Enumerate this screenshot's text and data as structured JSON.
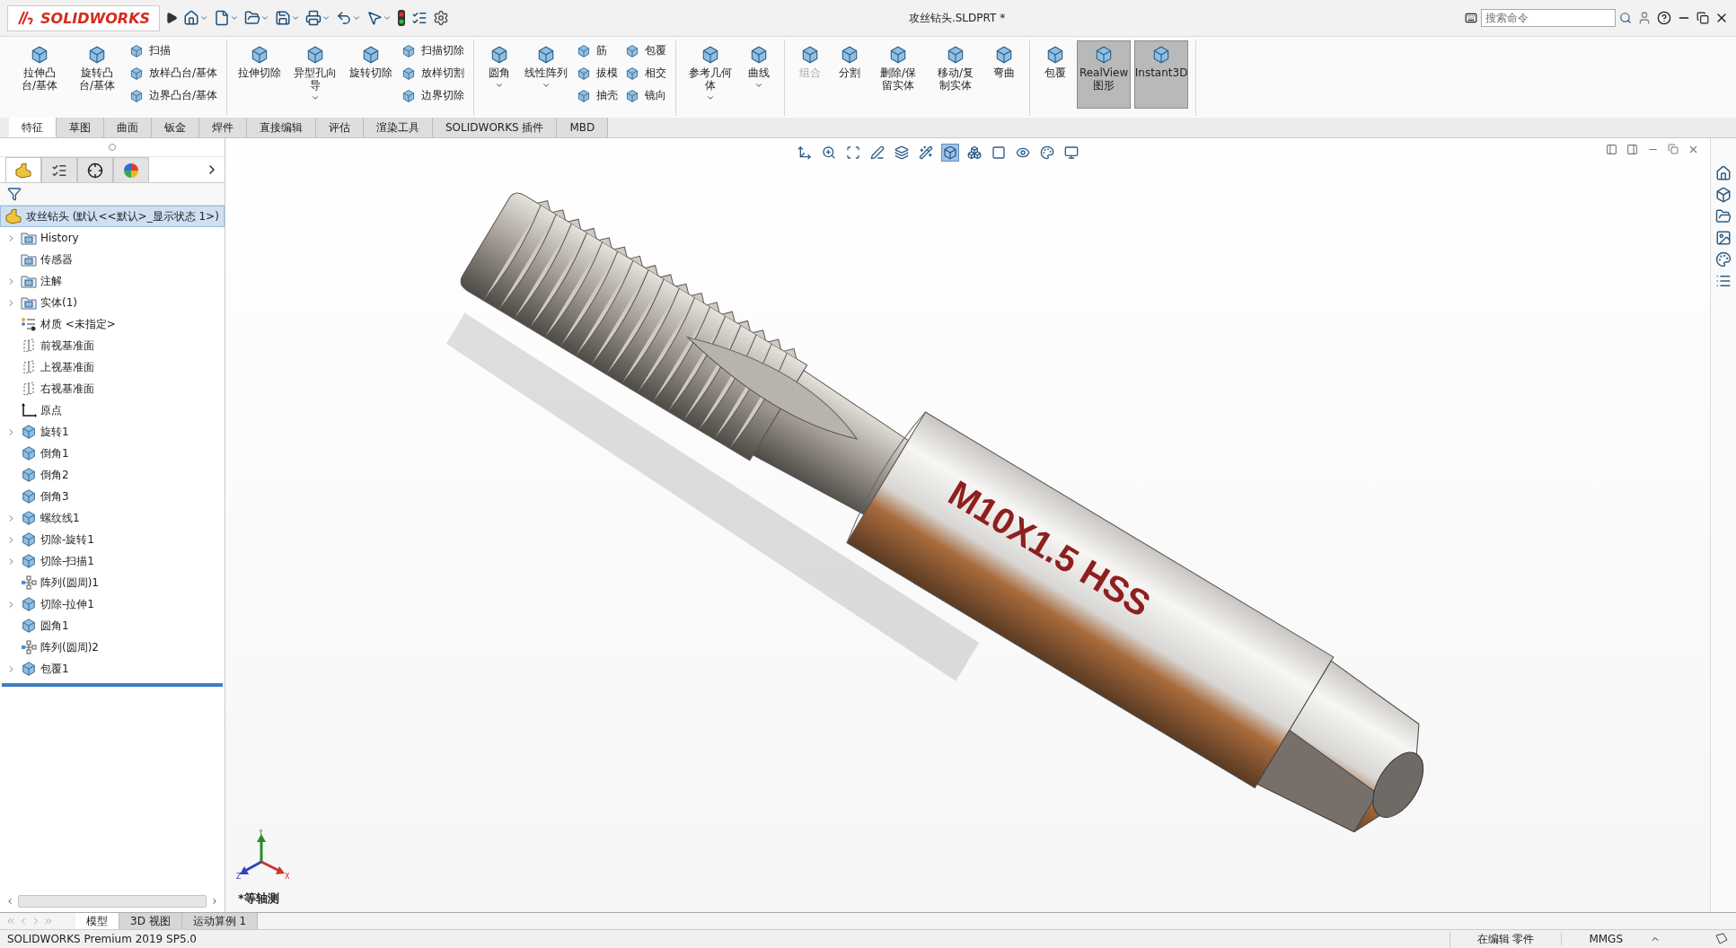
{
  "title_bar": {
    "logo": "SOLIDWORKS",
    "title": "攻丝钻头.SLDPRT *",
    "search": {
      "placeholder": "搜索命令"
    }
  },
  "ribbon": {
    "groups": [
      {
        "items": [
          {
            "kind": "large",
            "label": "拉伸凸台/基体",
            "dropdown": false,
            "disabled": false,
            "on": false
          },
          {
            "kind": "large",
            "label": "旋转凸台/基体",
            "dropdown": false,
            "disabled": false,
            "on": false
          },
          {
            "kind": "column",
            "items": [
              "扫描",
              "放样凸台/基体",
              "边界凸台/基体"
            ]
          }
        ]
      },
      {
        "items": [
          {
            "kind": "large",
            "label": "拉伸切除",
            "dropdown": false,
            "disabled": false,
            "on": false
          },
          {
            "kind": "large",
            "label": "异型孔向导",
            "dropdown": true,
            "disabled": false,
            "on": false
          },
          {
            "kind": "large",
            "label": "旋转切除",
            "dropdown": false,
            "disabled": false,
            "on": false
          },
          {
            "kind": "column",
            "items": [
              "扫描切除",
              "放样切割",
              "边界切除"
            ]
          }
        ]
      },
      {
        "items": [
          {
            "kind": "large",
            "label": "圆角",
            "dropdown": true,
            "disabled": false,
            "on": false
          },
          {
            "kind": "large",
            "label": "线性阵列",
            "dropdown": true,
            "disabled": false,
            "on": false
          },
          {
            "kind": "column",
            "items": [
              "筋",
              "拔模",
              "抽壳"
            ]
          },
          {
            "kind": "column",
            "items": [
              "包覆",
              "相交",
              "镜向"
            ]
          }
        ]
      },
      {
        "items": [
          {
            "kind": "large",
            "label": "参考几何体",
            "dropdown": true,
            "disabled": false,
            "on": false
          },
          {
            "kind": "large",
            "label": "曲线",
            "dropdown": true,
            "disabled": false,
            "on": false
          }
        ]
      },
      {
        "items": [
          {
            "kind": "large",
            "label": "组合",
            "dropdown": false,
            "disabled": true,
            "on": false
          },
          {
            "kind": "large",
            "label": "分割",
            "dropdown": false,
            "disabled": false,
            "on": false
          },
          {
            "kind": "large",
            "label": "删除/保留实体",
            "dropdown": false,
            "disabled": false,
            "on": false
          },
          {
            "kind": "large",
            "label": "移动/复制实体",
            "dropdown": false,
            "disabled": false,
            "on": false
          },
          {
            "kind": "large",
            "label": "弯曲",
            "dropdown": false,
            "disabled": false,
            "on": false
          }
        ]
      },
      {
        "items": [
          {
            "kind": "large",
            "label": "包覆",
            "dropdown": false,
            "disabled": false,
            "on": false
          },
          {
            "kind": "large",
            "label": "RealView图形",
            "dropdown": false,
            "disabled": false,
            "on": true
          },
          {
            "kind": "large",
            "label": "Instant3D",
            "dropdown": false,
            "disabled": false,
            "on": true
          }
        ]
      }
    ]
  },
  "ribbon_tabs": [
    {
      "label": "特征",
      "selected": true
    },
    {
      "label": "草图",
      "selected": false
    },
    {
      "label": "曲面",
      "selected": false
    },
    {
      "label": "钣金",
      "selected": false
    },
    {
      "label": "焊件",
      "selected": false
    },
    {
      "label": "直接编辑",
      "selected": false
    },
    {
      "label": "评估",
      "selected": false
    },
    {
      "label": "渲染工具",
      "selected": false
    },
    {
      "label": "SOLIDWORKS 插件",
      "selected": false
    },
    {
      "label": "MBD",
      "selected": false
    }
  ],
  "panel_tabs": [
    {
      "selected": true
    },
    {
      "selected": false
    },
    {
      "selected": false
    },
    {
      "selected": false
    }
  ],
  "tree": {
    "root": {
      "label": "攻丝钻头  (默认<<默认>_显示状态 1>)",
      "selected": true
    },
    "items": [
      {
        "label": "History",
        "kind": "folder",
        "expandable": true,
        "selected": false
      },
      {
        "label": "传感器",
        "kind": "folder",
        "expandable": false,
        "selected": false
      },
      {
        "label": "注解",
        "kind": "folder",
        "expandable": true,
        "selected": false
      },
      {
        "label": "实体(1)",
        "kind": "folder",
        "expandable": true,
        "selected": false
      },
      {
        "label": "材质 <未指定>",
        "kind": "material",
        "expandable": false,
        "selected": false
      },
      {
        "label": "前视基准面",
        "kind": "plane",
        "expandable": false,
        "selected": false
      },
      {
        "label": "上视基准面",
        "kind": "plane",
        "expandable": false,
        "selected": false
      },
      {
        "label": "右视基准面",
        "kind": "plane",
        "expandable": false,
        "selected": false
      },
      {
        "label": "原点",
        "kind": "origin",
        "expandable": false,
        "selected": false
      },
      {
        "label": "旋转1",
        "kind": "feature",
        "expandable": true,
        "selected": false
      },
      {
        "label": "倒角1",
        "kind": "feature",
        "expandable": false,
        "selected": false
      },
      {
        "label": "倒角2",
        "kind": "feature",
        "expandable": false,
        "selected": false
      },
      {
        "label": "倒角3",
        "kind": "feature",
        "expandable": false,
        "selected": false
      },
      {
        "label": "螺纹线1",
        "kind": "feature",
        "expandable": true,
        "selected": false
      },
      {
        "label": "切除-旋转1",
        "kind": "feature",
        "expandable": true,
        "selected": false
      },
      {
        "label": "切除-扫描1",
        "kind": "feature",
        "expandable": true,
        "selected": false
      },
      {
        "label": "阵列(圆周)1",
        "kind": "pattern",
        "expandable": false,
        "selected": false
      },
      {
        "label": "切除-拉伸1",
        "kind": "feature",
        "expandable": true,
        "selected": false
      },
      {
        "label": "圆角1",
        "kind": "feature",
        "expandable": false,
        "selected": false
      },
      {
        "label": "阵列(圆周)2",
        "kind": "pattern",
        "expandable": false,
        "selected": false
      },
      {
        "label": "包覆1",
        "kind": "feature",
        "expandable": true,
        "selected": false
      }
    ]
  },
  "viewport": {
    "engraving": "M10X1.5 HSS",
    "view_name": "*等轴测",
    "triad": {
      "x": "X",
      "y": "Y",
      "z": "Z"
    }
  },
  "bottom_tabs": [
    {
      "label": "模型",
      "selected": true
    },
    {
      "label": "3D 视图",
      "selected": false
    },
    {
      "label": "运动算例 1",
      "selected": false
    }
  ],
  "status_bar": {
    "product": "SOLIDWORKS Premium 2019 SP5.0",
    "mode": "在编辑 零件",
    "units": "MMGS"
  }
}
